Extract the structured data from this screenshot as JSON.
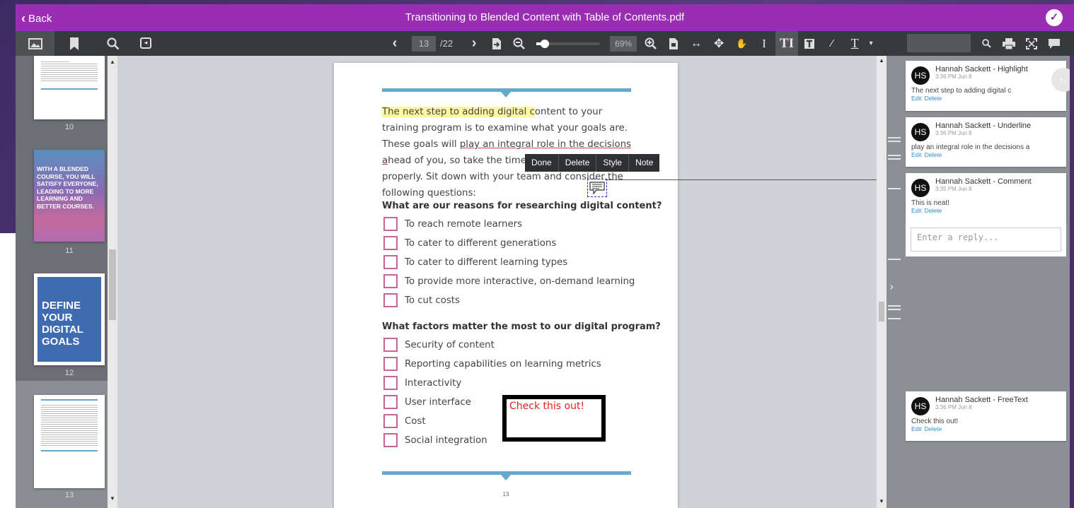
{
  "header": {
    "back_label": "Back",
    "title": "Transitioning to Blended Content with Table of Contents.pdf"
  },
  "toolbar": {
    "current_page": "13",
    "total_pages": "/22",
    "zoom": "69%"
  },
  "thumbnails": [
    {
      "number": "10"
    },
    {
      "number": "11",
      "text": "WITH A BLENDED COURSE, YOU WILL SATISFY EVERYONE, LEADING TO MORE LEARNING AND BETTER COURSES."
    },
    {
      "number": "12",
      "text": "DEFINE YOUR DIGITAL GOALS"
    },
    {
      "number": "13"
    }
  ],
  "document": {
    "paragraph": {
      "highlighted": "The next step to adding digital c",
      "after_highlight": "ontent to your training program is to examine what your goals are. These goals will ",
      "underlined": "play an integral role in the decisions a",
      "rest": "head of you, so take the time to think about them properly. Sit down with your team and consider the following questions:"
    },
    "popup_menu": [
      "Done",
      "Delete",
      "Style",
      "Note"
    ],
    "section1": {
      "heading": "What are our reasons for researching digital content?",
      "items": [
        "To reach remote learners",
        "To cater to different generations",
        "To cater to different learning types",
        "To provide more interactive, on-demand learning",
        "To cut costs"
      ]
    },
    "section2": {
      "heading": "What factors matter the most to our digital program?",
      "items": [
        "Security of content",
        "Reporting capabilities on learning metrics",
        "Interactivity",
        "User interface",
        "Cost",
        "Social integration"
      ]
    },
    "freetext": "Check this out!",
    "page_number": "13"
  },
  "notes": [
    {
      "initials": "HS",
      "who": "Hannah Sackett - Highlight",
      "time": "3:36 PM Jun 8",
      "body": "The next step to adding digital c",
      "edit": "Edit",
      "delete": "Delete"
    },
    {
      "initials": "HS",
      "who": "Hannah Sackett - Underline",
      "time": "3:36 PM Jun 8",
      "body": "play an integral role in the decisions a",
      "edit": "Edit",
      "delete": "Delete"
    },
    {
      "initials": "HS",
      "who": "Hannah Sackett - Comment",
      "time": "3:35 PM Jun 8",
      "body": "This is neat!",
      "edit": "Edit",
      "delete": "Delete"
    },
    {
      "initials": "HS",
      "who": "Hannah Sackett - FreeText",
      "time": "3:36 PM Jun 8",
      "body": "Check this out!",
      "edit": "Edit",
      "delete": "Delete"
    }
  ],
  "reply_placeholder": "Enter a reply...",
  "colors": {
    "titlebar": "#9a2db3",
    "highlight": "#fbf8a0",
    "checkbox": "#c2669a",
    "rule": "#66a9cf",
    "link": "#2a8ed3"
  }
}
